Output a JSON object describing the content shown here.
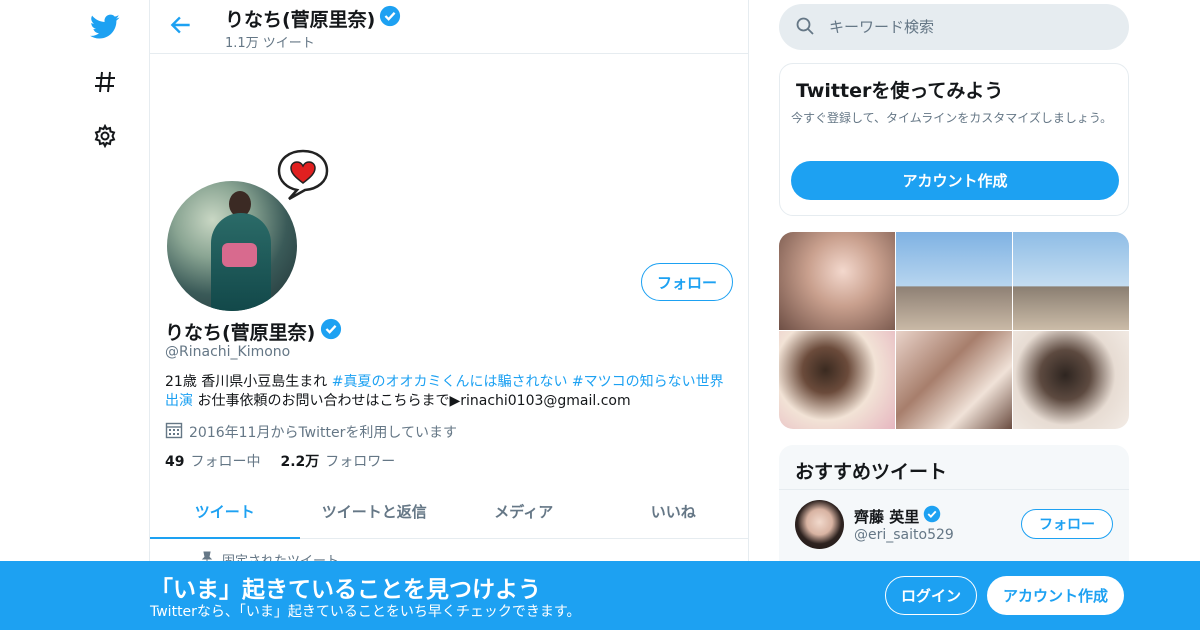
{
  "nav": {
    "icons": [
      "twitter-logo-icon",
      "hashtag-icon",
      "gear-icon"
    ]
  },
  "header": {
    "name": "りなち(菅原里奈)",
    "tweet_count": "1.1万 ツイート"
  },
  "profile": {
    "name": "りなち(菅原里奈)",
    "handle": "@Rinachi_Kimono",
    "follow_label": "フォロー",
    "bio_prefix": "21歳 香川県小豆島生まれ ",
    "bio_tag1": "#真夏のオオカミくんには騙されない",
    "bio_sep": " ",
    "bio_tag2": "#マツコの知らない世界出演",
    "bio_suffix": " お仕事依頼のお問い合わせはこちらまで▶rinachi0103@gmail.com",
    "joined": "2016年11月からTwitterを利用しています",
    "following_count": "49",
    "following_label": "フォロー中",
    "followers_count": "2.2万",
    "followers_label": "フォロワー"
  },
  "tabs": [
    {
      "label": "ツイート",
      "active": true
    },
    {
      "label": "ツイートと返信",
      "active": false
    },
    {
      "label": "メディア",
      "active": false
    },
    {
      "label": "いいね",
      "active": false
    }
  ],
  "pinned_label": "固定されたツイート",
  "search": {
    "placeholder": "キーワード検索"
  },
  "signup_card": {
    "title": "Twitterを使ってみよう",
    "description": "今すぐ登録して、タイムラインをカスタマイズしましょう。",
    "button": "アカウント作成"
  },
  "recommended": {
    "title": "おすすめツイート",
    "user_name": "齊藤 英里",
    "user_handle": "@eri_saito529",
    "follow_label": "フォロー"
  },
  "bottom_bar": {
    "title": "「いま」起きていることを見つけよう",
    "subtitle": "Twitterなら、「いま」起きていることをいち早くチェックできます。",
    "login": "ログイン",
    "signup": "アカウント作成"
  },
  "colors": {
    "accent": "#1da1f2",
    "text": "#14171a",
    "muted": "#657786",
    "border": "#e6ecf0"
  }
}
